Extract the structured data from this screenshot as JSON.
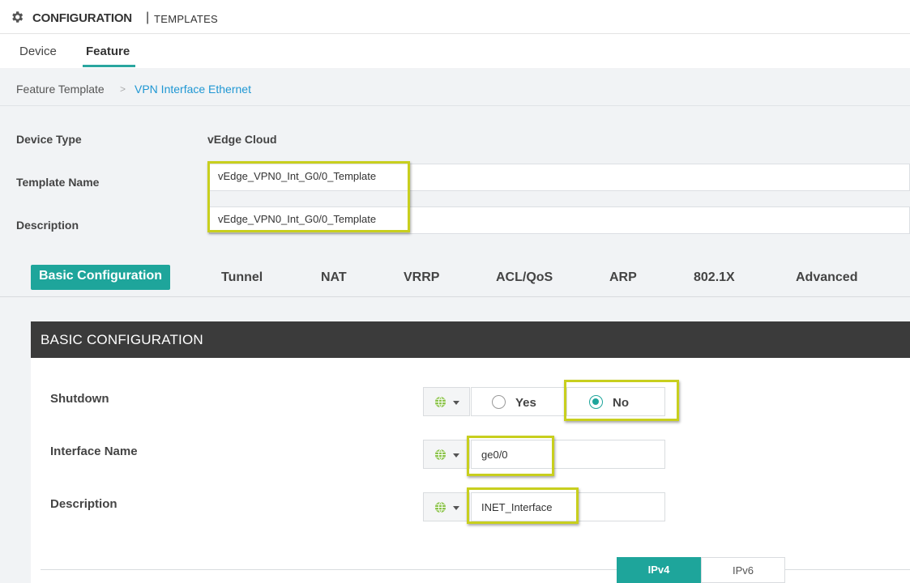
{
  "header": {
    "title": "CONFIGURATION",
    "separator": "|",
    "subtitle": "TEMPLATES"
  },
  "tabs": [
    {
      "label": "Device"
    },
    {
      "label": "Feature",
      "active": true
    }
  ],
  "breadcrumb": {
    "parent": "Feature Template",
    "arrow": ">",
    "current": "VPN Interface Ethernet"
  },
  "form": {
    "device_type_label": "Device Type",
    "device_type_value": "vEdge Cloud",
    "template_name_label": "Template Name",
    "template_name_value": "vEdge_VPN0_Int_G0/0_Template",
    "description_label": "Description",
    "description_value": "vEdge_VPN0_Int_G0/0_Template"
  },
  "section_tabs": [
    {
      "label": "Basic Configuration",
      "active": true
    },
    {
      "label": "Tunnel"
    },
    {
      "label": "NAT"
    },
    {
      "label": "VRRP"
    },
    {
      "label": "ACL/QoS"
    },
    {
      "label": "ARP"
    },
    {
      "label": "802.1X"
    },
    {
      "label": "Advanced"
    }
  ],
  "basic": {
    "heading": "BASIC CONFIGURATION",
    "shutdown_label": "Shutdown",
    "shutdown_yes": "Yes",
    "shutdown_no": "No",
    "shutdown_selected": "No",
    "interface_name_label": "Interface Name",
    "interface_name_value": "ge0/0",
    "description_label": "Description",
    "description_value": "INET_Interface"
  },
  "ip_toggle": {
    "ipv4": "IPv4",
    "ipv6": "IPv6",
    "selected": "IPv4"
  },
  "colors": {
    "accent": "#1ea59b",
    "highlight": "#c8cf1e",
    "link": "#1f97d3",
    "panel_header": "#3b3b3b"
  },
  "icons": {
    "header": "gear-icon",
    "scope": "globe-icon"
  }
}
